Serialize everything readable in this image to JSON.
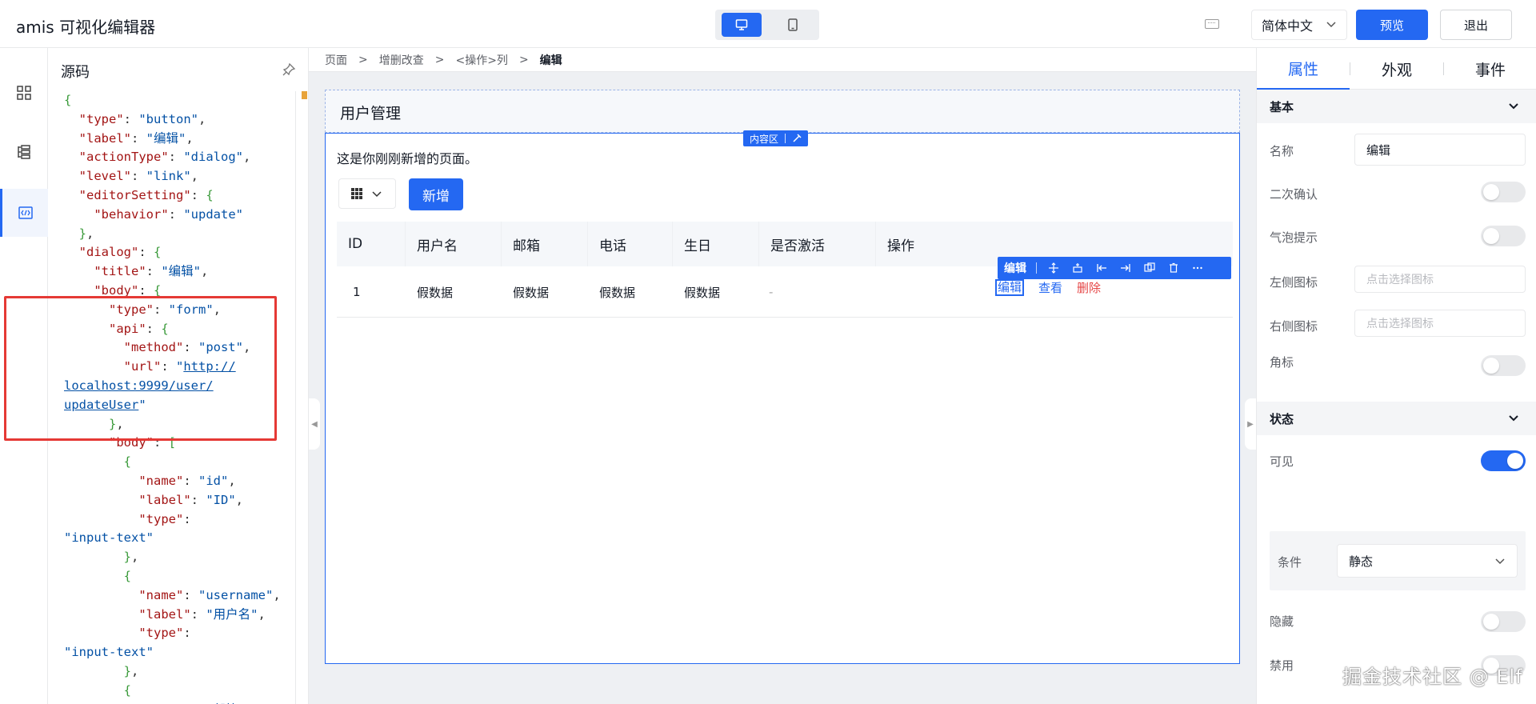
{
  "header": {
    "title": "amis 可视化编辑器",
    "language": "简体中文",
    "preview_label": "预览",
    "exit_label": "退出",
    "accent": "#2468f2"
  },
  "code_panel": {
    "title": "源码",
    "lines": [
      [
        [
          "b",
          "{"
        ]
      ],
      [
        [
          "p",
          "  "
        ],
        [
          "k",
          "\"type\""
        ],
        [
          "p",
          ": "
        ],
        [
          "s",
          "\"button\""
        ],
        [
          "p",
          ","
        ]
      ],
      [
        [
          "p",
          "  "
        ],
        [
          "k",
          "\"label\""
        ],
        [
          "p",
          ": "
        ],
        [
          "s",
          "\"编辑\""
        ],
        [
          "p",
          ","
        ]
      ],
      [
        [
          "p",
          "  "
        ],
        [
          "k",
          "\"actionType\""
        ],
        [
          "p",
          ": "
        ],
        [
          "s",
          "\"dialog\""
        ],
        [
          "p",
          ","
        ]
      ],
      [
        [
          "p",
          "  "
        ],
        [
          "k",
          "\"level\""
        ],
        [
          "p",
          ": "
        ],
        [
          "s",
          "\"link\""
        ],
        [
          "p",
          ","
        ]
      ],
      [
        [
          "p",
          "  "
        ],
        [
          "k",
          "\"editorSetting\""
        ],
        [
          "p",
          ": "
        ],
        [
          "b",
          "{"
        ]
      ],
      [
        [
          "p",
          "    "
        ],
        [
          "k",
          "\"behavior\""
        ],
        [
          "p",
          ": "
        ],
        [
          "s",
          "\"update\""
        ]
      ],
      [
        [
          "p",
          "  "
        ],
        [
          "b",
          "}"
        ],
        [
          "p",
          ","
        ]
      ],
      [
        [
          "p",
          "  "
        ],
        [
          "k",
          "\"dialog\""
        ],
        [
          "p",
          ": "
        ],
        [
          "b",
          "{"
        ]
      ],
      [
        [
          "p",
          "    "
        ],
        [
          "k",
          "\"title\""
        ],
        [
          "p",
          ": "
        ],
        [
          "s",
          "\"编辑\""
        ],
        [
          "p",
          ","
        ]
      ],
      [
        [
          "p",
          "    "
        ],
        [
          "k",
          "\"body\""
        ],
        [
          "p",
          ": "
        ],
        [
          "b",
          "{"
        ]
      ],
      [
        [
          "p",
          "      "
        ],
        [
          "k",
          "\"type\""
        ],
        [
          "p",
          ": "
        ],
        [
          "s",
          "\"form\""
        ],
        [
          "p",
          ","
        ]
      ],
      [
        [
          "p",
          "      "
        ],
        [
          "k",
          "\"api\""
        ],
        [
          "p",
          ": "
        ],
        [
          "b",
          "{"
        ]
      ],
      [
        [
          "p",
          "        "
        ],
        [
          "k",
          "\"method\""
        ],
        [
          "p",
          ": "
        ],
        [
          "s",
          "\"post\""
        ],
        [
          "p",
          ","
        ]
      ],
      [
        [
          "p",
          "        "
        ],
        [
          "k",
          "\"url\""
        ],
        [
          "p",
          ": "
        ],
        [
          "s",
          "\""
        ],
        [
          "l",
          "http://"
        ]
      ],
      [
        [
          "l",
          "localhost:9999/user/"
        ]
      ],
      [
        [
          "l",
          "updateUser"
        ],
        [
          "s",
          "\""
        ]
      ],
      [
        [
          "p",
          "      "
        ],
        [
          "b",
          "}"
        ],
        [
          "p",
          ","
        ]
      ],
      [
        [
          "p",
          "      "
        ],
        [
          "k",
          "\"body\""
        ],
        [
          "p",
          ": "
        ],
        [
          "b",
          "["
        ]
      ],
      [
        [
          "p",
          "        "
        ],
        [
          "b",
          "{"
        ]
      ],
      [
        [
          "p",
          "          "
        ],
        [
          "k",
          "\"name\""
        ],
        [
          "p",
          ": "
        ],
        [
          "s",
          "\"id\""
        ],
        [
          "p",
          ","
        ]
      ],
      [
        [
          "p",
          "          "
        ],
        [
          "k",
          "\"label\""
        ],
        [
          "p",
          ": "
        ],
        [
          "s",
          "\"ID\""
        ],
        [
          "p",
          ","
        ]
      ],
      [
        [
          "p",
          "          "
        ],
        [
          "k",
          "\"type\""
        ],
        [
          "p",
          ":"
        ]
      ],
      [
        [
          "s",
          "\"input-text\""
        ]
      ],
      [
        [
          "p",
          "        "
        ],
        [
          "b",
          "}"
        ],
        [
          "p",
          ","
        ]
      ],
      [
        [
          "p",
          "        "
        ],
        [
          "b",
          "{"
        ]
      ],
      [
        [
          "p",
          "          "
        ],
        [
          "k",
          "\"name\""
        ],
        [
          "p",
          ": "
        ],
        [
          "s",
          "\"username\""
        ],
        [
          "p",
          ","
        ]
      ],
      [
        [
          "p",
          "          "
        ],
        [
          "k",
          "\"label\""
        ],
        [
          "p",
          ": "
        ],
        [
          "s",
          "\"用户名\""
        ],
        [
          "p",
          ","
        ]
      ],
      [
        [
          "p",
          "          "
        ],
        [
          "k",
          "\"type\""
        ],
        [
          "p",
          ":"
        ]
      ],
      [
        [
          "s",
          "\"input-text\""
        ]
      ],
      [
        [
          "p",
          "        "
        ],
        [
          "b",
          "}"
        ],
        [
          "p",
          ","
        ]
      ],
      [
        [
          "p",
          "        "
        ],
        [
          "b",
          "{"
        ]
      ],
      [
        [
          "p",
          "          "
        ],
        [
          "k",
          "\"label\""
        ],
        [
          "p",
          ": "
        ],
        [
          "s",
          "\"邮箱\""
        ]
      ]
    ]
  },
  "breadcrumb": [
    "页面",
    "增删改查",
    "<操作>列",
    "编辑"
  ],
  "page": {
    "title": "用户管理",
    "region_tag": "内容区",
    "intro": "这是你刚刚新增的页面。",
    "add_button": "新增"
  },
  "table": {
    "columns": [
      "ID",
      "用户名",
      "邮箱",
      "电话",
      "生日",
      "是否激活",
      "操作"
    ],
    "rows": [
      [
        "1",
        "假数据",
        "假数据",
        "假数据",
        "假数据",
        "-"
      ]
    ],
    "actions": [
      "编辑",
      "查看",
      "删除"
    ],
    "toolbar_label": "编辑"
  },
  "right_panel": {
    "tabs": [
      "属性",
      "外观",
      "事件"
    ],
    "section_basic": "基本",
    "fields": {
      "name_label": "名称",
      "name_value": "编辑",
      "confirm_label": "二次确认",
      "tooltip_label": "气泡提示",
      "left_icon_label": "左侧图标",
      "left_icon_placeholder": "点击选择图标",
      "right_icon_label": "右侧图标",
      "right_icon_placeholder": "点击选择图标",
      "badge_label": "角标"
    },
    "section_state": "状态",
    "state": {
      "visible_label": "可见",
      "condition_label": "条件",
      "condition_value": "静态",
      "hidden_label": "隐藏",
      "disabled_label": "禁用"
    }
  },
  "watermark": "掘金技术社区 @ Elf"
}
